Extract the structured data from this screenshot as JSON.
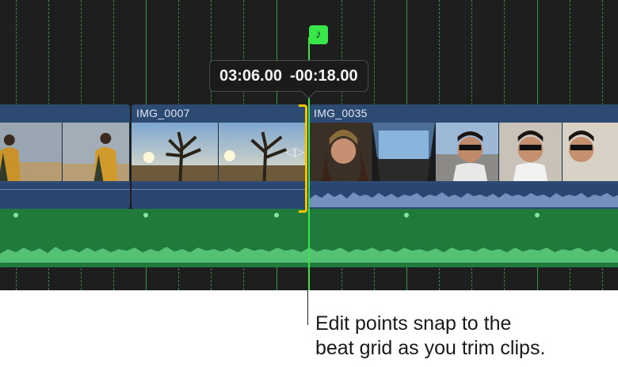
{
  "tooltip": {
    "position": "03:06.00",
    "delta": "-00:18.00"
  },
  "marker": {
    "icon": "music-note-icon",
    "glyph": "♪"
  },
  "clips": [
    {
      "name": ""
    },
    {
      "name": "IMG_0007"
    },
    {
      "name": "IMG_0035"
    }
  ],
  "callout": {
    "line1": "Edit points snap to the",
    "line2": "beat grid as you trim clips."
  },
  "colors": {
    "background": "#1e1e1e",
    "clip": "#2d4a73",
    "music": "#1f7a3c",
    "beat_grid": "#3fae52",
    "playhead": "#39e649",
    "trim": "#f4c400"
  }
}
